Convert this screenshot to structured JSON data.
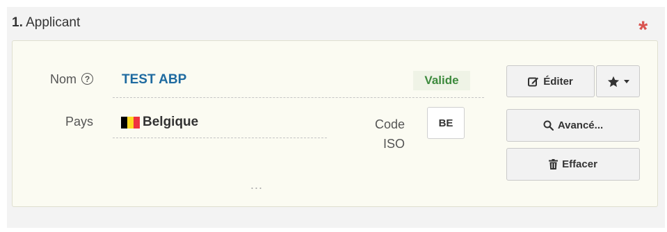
{
  "section": {
    "number": "1.",
    "title": "Applicant",
    "required_mark": "*"
  },
  "fields": {
    "name_label": "Nom",
    "help_icon": "?",
    "name_value": "TEST ABP",
    "status": "Valide",
    "country_label": "Pays",
    "country_value": "Belgique",
    "flag_colors": [
      "#000000",
      "#fdda24",
      "#ef3340"
    ],
    "iso_label": "Code ISO",
    "iso_value": "BE",
    "more": "..."
  },
  "buttons": {
    "edit": "Éditer",
    "favorites_icon": "star-icon",
    "advanced": "Avancé...",
    "clear": "Effacer"
  }
}
